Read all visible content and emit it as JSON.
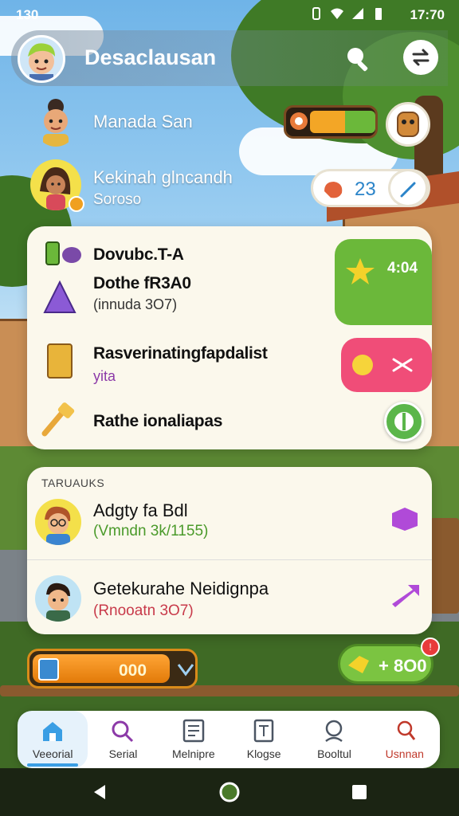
{
  "status_bar": {
    "time_left": "130",
    "time_right": "17:70"
  },
  "header": {
    "title": "Desaclausan"
  },
  "friends": [
    {
      "name": "Manada San"
    },
    {
      "name": "Kekinah glncandh",
      "sub": "Soroso"
    }
  ],
  "counters": {
    "score_pill": "23",
    "tab_green_value": "4:04"
  },
  "quests": [
    {
      "title": "Dovubc.T-A"
    },
    {
      "title": "Dothe fR3A0",
      "sub": "(innuda 3O7)"
    },
    {
      "title": "Rasverinatingfapdalist",
      "sub": "yita"
    },
    {
      "title": "Rathe ionaliapas"
    }
  ],
  "leaderboard": {
    "header": "TARUAUKS",
    "entries": [
      {
        "name": "Adgty fa Bdl",
        "sub": "(Vmndn 3k/1155)",
        "sub_color": "#4a9a2a"
      },
      {
        "name": "Getekurahe Neidignpa",
        "sub": "(Rnooatn 3O7)",
        "sub_color": "#c83a4a"
      }
    ]
  },
  "coins": {
    "value": "000",
    "fill": 0.86
  },
  "cash": {
    "value": "+ 8O0",
    "badge": "!"
  },
  "nav": [
    {
      "label": "Veeorial",
      "icon": "home-icon",
      "active": true,
      "color": "#2b84c9"
    },
    {
      "label": "Serial",
      "icon": "search-icon",
      "active": false,
      "color": "#8c3aa8"
    },
    {
      "label": "Melnipre",
      "icon": "list-icon",
      "active": false,
      "color": "#4b5563"
    },
    {
      "label": "Klogse",
      "icon": "document-icon",
      "active": false,
      "color": "#4b5563"
    },
    {
      "label": "Booltul",
      "icon": "chat-icon",
      "active": false,
      "color": "#4b5563"
    },
    {
      "label": "Usnnan",
      "icon": "profile-icon",
      "active": false,
      "color": "#c0392b"
    }
  ],
  "colors": {
    "accent_green": "#6bb83a",
    "accent_pink": "#f04d78",
    "accent_orange": "#e27a08",
    "accent_blue": "#3a9ee4"
  }
}
